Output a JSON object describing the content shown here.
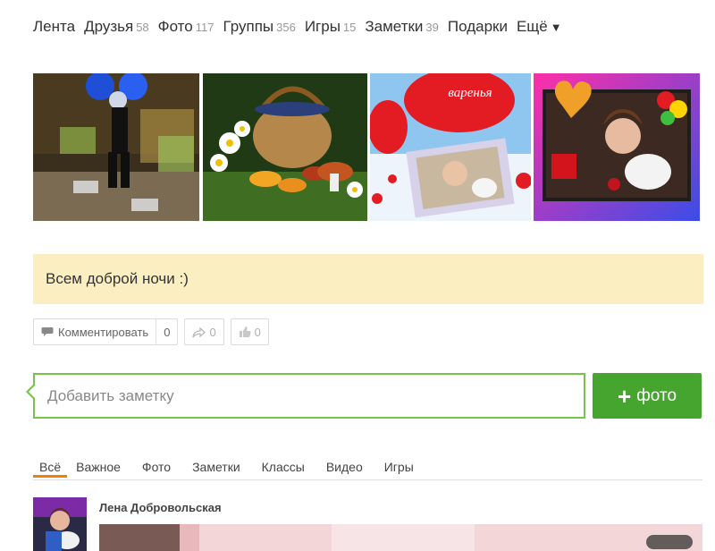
{
  "nav": {
    "items": [
      {
        "label": "Лента",
        "count": ""
      },
      {
        "label": "Друзья",
        "count": "58"
      },
      {
        "label": "Фото",
        "count": "117"
      },
      {
        "label": "Группы",
        "count": "356"
      },
      {
        "label": "Игры",
        "count": "15"
      },
      {
        "label": "Заметки",
        "count": "39"
      },
      {
        "label": "Подарки",
        "count": ""
      },
      {
        "label": "Ещё",
        "count": ""
      }
    ],
    "more_arrow": "▼"
  },
  "status": {
    "text": "Всем доброй ночи :)"
  },
  "actions": {
    "comment_label": "Комментировать",
    "comment_count": "0",
    "share_count": "0",
    "like_count": "0"
  },
  "note": {
    "placeholder": "Добавить заметку"
  },
  "photo_button": {
    "plus": "+",
    "label": "фото"
  },
  "photos": {
    "card3_text": "варенья"
  },
  "tabs": [
    "Всё",
    "Важное",
    "Фото",
    "Заметки",
    "Классы",
    "Видео",
    "Игры"
  ],
  "feed": {
    "author": "Лена Добровольская"
  },
  "colors": {
    "accent_green": "#46a52e",
    "border_green": "#77c44d",
    "status_bg": "#fbeec0",
    "tab_active": "#ee8208"
  }
}
